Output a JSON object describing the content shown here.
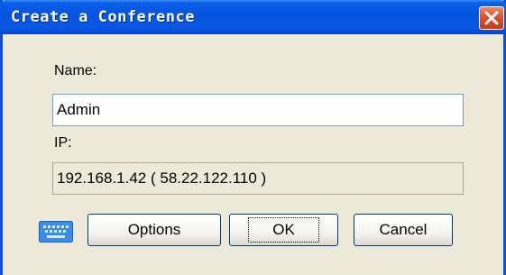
{
  "window": {
    "title": "Create a Conference"
  },
  "form": {
    "name_label": "Name:",
    "name_value": "Admin",
    "ip_label": "IP:",
    "ip_value": "192.168.1.42 ( 58.22.122.110 )"
  },
  "buttons": {
    "options": "Options",
    "ok": "OK",
    "cancel": "Cancel"
  },
  "icons": {
    "keyboard": "keyboard-icon",
    "close": "close-icon"
  },
  "colors": {
    "titlebar": "#0554e0",
    "close": "#d9532e",
    "window_bg": "#ece9d8"
  }
}
